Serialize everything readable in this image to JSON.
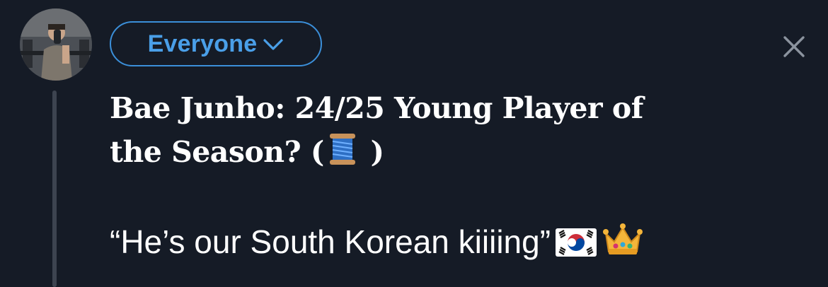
{
  "composer": {
    "audience_label": "Everyone",
    "headline_line1": "Bae Junho: 24/25 Young Player of",
    "headline_line2_text": "the Season? (",
    "headline_line2_close": ")",
    "quote_text": "“He’s our South Korean kiiiing”",
    "emojis": {
      "spool": "spool-of-thread-icon",
      "flag": "south-korea-flag-icon",
      "crown": "crown-icon"
    }
  },
  "colors": {
    "background": "#151b26",
    "accent": "#4a9fe8",
    "text": "#ffffff",
    "thread_line": "#3d4450",
    "close_icon": "#8b939e"
  }
}
